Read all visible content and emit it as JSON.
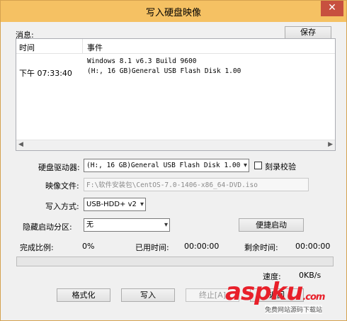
{
  "window": {
    "title": "写入硬盘映像",
    "close_glyph": "✕"
  },
  "log": {
    "label": "消息:",
    "save_button": "保存",
    "columns": [
      "时间",
      "事件"
    ],
    "rows": [
      {
        "time": "",
        "event": "Windows 8.1 v6.3 Build 9600"
      },
      {
        "time": "下午 07:33:40",
        "event": "(H:, 16 GB)General USB Flash Disk  1.00"
      }
    ],
    "scroll_left": "◀",
    "scroll_right": "▶"
  },
  "form": {
    "drive_label": "硬盘驱动器:",
    "drive_value": "(H:, 16 GB)General USB Flash Disk  1.00",
    "verify_label": "刻录校验",
    "verify_checked": false,
    "image_label": "映像文件:",
    "image_value": "F:\\软件安装包\\CentOS-7.0-1406-x86_64-DVD.iso",
    "method_label": "写入方式:",
    "method_value": "USB-HDD+ v2",
    "hidden_label": "隐藏启动分区:",
    "hidden_value": "无",
    "quick_boot_button": "便捷启动",
    "chevron": "▾"
  },
  "status": {
    "progress_label": "完成比例:",
    "progress_value": "0%",
    "progress_fraction": 0,
    "elapsed_label": "已用时间:",
    "elapsed_value": "00:00:00",
    "remaining_label": "剩余时间:",
    "remaining_value": "00:00:00",
    "speed_label": "速度:",
    "speed_value": "0KB/s"
  },
  "buttons": {
    "format": "格式化",
    "write": "写入",
    "stop": "终止[A]",
    "back": "返回"
  },
  "watermark": {
    "logo": "aspku",
    "logo_suffix": ".com",
    "subtitle": "免费网站源码下载站"
  },
  "colors": {
    "titlebar": "#f5c163",
    "close": "#c7503f",
    "progress": "#06b025",
    "watermark": "#e8202a"
  }
}
